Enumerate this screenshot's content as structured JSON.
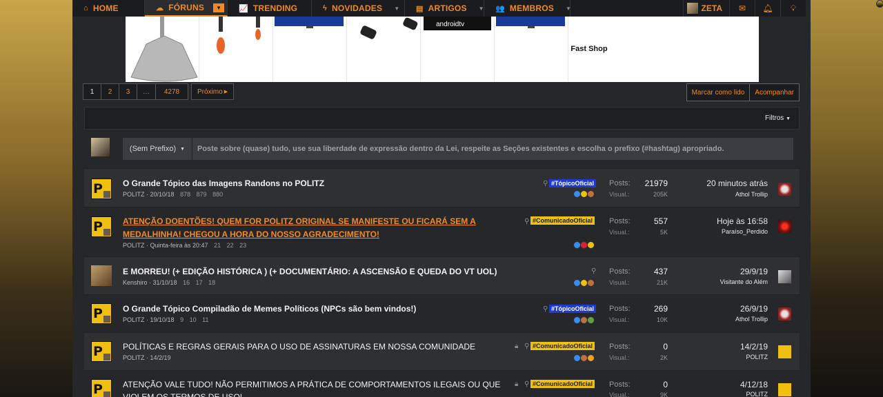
{
  "nav": {
    "items": [
      {
        "label": "HOME",
        "icon": "home-icon"
      },
      {
        "label": "FÓRUNS",
        "icon": "comments-icon"
      },
      {
        "label": "TRENDING",
        "icon": "chart-line-icon"
      },
      {
        "label": "NOVIDADES",
        "icon": "bolt-icon"
      },
      {
        "label": "ARTIGOS",
        "icon": "document-icon"
      },
      {
        "label": "MEMBROS",
        "icon": "users-icon"
      }
    ],
    "user": "ZETA",
    "accent": "#f08a24"
  },
  "banner": {
    "shop_name": "Fast Shop",
    "tv_label": "androidtv"
  },
  "pagination": {
    "pages": [
      "1",
      "2",
      "3",
      "…",
      "4278"
    ],
    "next": "Próximo"
  },
  "actions": {
    "mark_read": "Marcar como lido",
    "follow": "Acompanhar"
  },
  "filters": {
    "label": "Filtros"
  },
  "new_thread": {
    "prefix": "(Sem Prefixo)",
    "placeholder": "Poste sobre (quase) tudo, use sua liberdade de expressão dentro da Lei, respeite as Seções existentes e escolha o prefixo (#hashtag) apropriado."
  },
  "stat_labels": {
    "posts": "Posts:",
    "views": "Visual.:"
  },
  "threads": [
    {
      "title": "O Grande Tópico das Imagens Randons no POLITZ",
      "author": "POLITZ",
      "date": "20/10/18",
      "pages": [
        "878",
        "879",
        "880"
      ],
      "tag": "#TópicoOficial",
      "posts": "21979",
      "views": "205K",
      "last_time": "20 minutos atrás",
      "last_user": "Athol Trollip"
    },
    {
      "title_line1": "ATENÇÃO DOENTÕES! QUEM FOR POLITZ ORIGINAL SE MANIFESTE OU FICARÁ SEM A",
      "title_line2": "MEDALHINHA! CHEGOU A HORA DO NOSSO AGRADECIMENTO!",
      "author": "POLITZ",
      "date": "Quinta-feira às 20:47",
      "pages": [
        "21",
        "22",
        "23"
      ],
      "tag": "#ComunicadoOficial",
      "posts": "557",
      "views": "5K",
      "last_time": "Hoje às 16:58",
      "last_user": "Paraíso_Perdido"
    },
    {
      "title": "E MORREU! (+ EDIÇÃO HISTÓRICA ) (+ DOCUMENTÁRIO: A ASCENSÃO E QUEDA DO VT UOL)",
      "author": "Kenshiro",
      "date": "31/10/18",
      "pages": [
        "16",
        "17",
        "18"
      ],
      "posts": "437",
      "views": "21K",
      "last_time": "29/9/19",
      "last_user": "Visitante do Além"
    },
    {
      "title": "O Grande Tópico Compiladão de Memes Políticos (NPCs são bem vindos!)",
      "author": "POLITZ",
      "date": "19/10/18",
      "pages": [
        "9",
        "10",
        "11"
      ],
      "tag": "#TópicoOficial",
      "posts": "269",
      "views": "10K",
      "last_time": "26/9/19",
      "last_user": "Athol Trollip"
    },
    {
      "title": "POLÍTICAS E REGRAS GERAIS PARA O USO DE ASSINATURAS EM NOSSA COMUNIDADE",
      "author": "POLITZ",
      "date": "14/2/19",
      "tag": "#ComunicadoOficial",
      "posts": "0",
      "views": "2K",
      "last_time": "14/2/19",
      "last_user": "POLITZ"
    },
    {
      "title_line1": "ATENÇÃO VALE TUDO! NÃO PERMITIMOS A PRÁTICA DE COMPORTAMENTOS ILEGAIS OU QUE",
      "title_line2": "VIOLEM OS TERMOS DE USO!",
      "tag": "#ComunicadoOficial",
      "posts": "0",
      "views": "9K",
      "last_time": "4/12/18",
      "last_user": "POLITZ"
    }
  ],
  "logo_letter": "P"
}
